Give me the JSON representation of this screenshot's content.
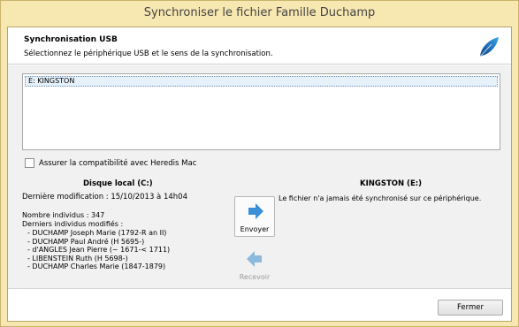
{
  "window": {
    "title": "Synchroniser le fichier Famille Duchamp"
  },
  "header": {
    "title": "Synchronisation USB",
    "subtitle": "Sélectionnez le périphérique USB et le sens de la synchronisation.",
    "icon": "feather-icon"
  },
  "devices": {
    "items": [
      "E: KINGSTON"
    ],
    "selected": "E: KINGSTON"
  },
  "options": {
    "compat_label": "Assurer la compatibilité avec Heredis Mac",
    "compat_checked": false
  },
  "local": {
    "title": "Disque local (C:)",
    "last_modified": "Dernière modification : 15/10/2013 à 14h04",
    "count": "Nombre individus : 347",
    "recent_title": "Derniers individus modifiés :",
    "recent": [
      "- DUCHAMP Joseph Marie (1792-R an II)",
      "- DUCHAMP Paul André (H 5695-)",
      "- d'ANGLES Jean Pierre (~ 1671-< 1711)",
      "- LIBENSTEIN Ruth (H 5698-)",
      "- DUCHAMP Charles Marie (1847-1879)"
    ]
  },
  "remote": {
    "title": "KINGSTON (E:)",
    "status": "Le fichier n'a jamais été synchronisé sur ce périphérique."
  },
  "actions": {
    "send_label": "Envoyer",
    "receive_label": "Recevoir",
    "close_label": "Fermer"
  },
  "colors": {
    "frame": "#f7e7b0",
    "selection": "#e5f1fb",
    "arrow": "#3a8fd6",
    "arrow_disabled": "#8db9dd"
  }
}
